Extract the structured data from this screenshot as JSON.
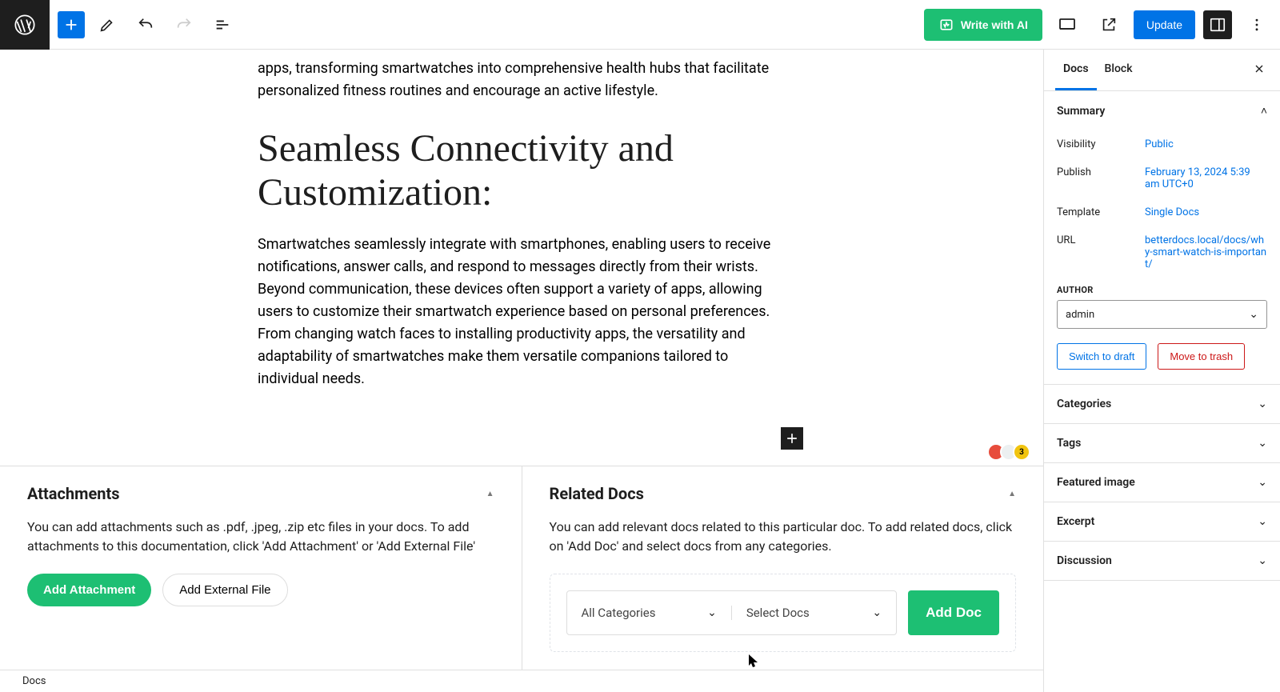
{
  "toolbar": {
    "write_ai": "Write with AI",
    "update": "Update"
  },
  "content": {
    "partial_paragraph": "apps, transforming smartwatches into comprehensive health hubs that facilitate personalized fitness routines and encourage an active lifestyle.",
    "heading": "Seamless Connectivity and Customization:",
    "paragraph2": "Smartwatches seamlessly integrate with smartphones, enabling users to receive notifications, answer calls, and respond to messages directly from their wrists. Beyond communication, these devices often support a variety of apps, allowing users to customize their smartwatch experience based on personal preferences. From changing watch faces to installing productivity apps, the versatility and adaptability of smartwatches make them versatile companions tailored to individual needs."
  },
  "attachments": {
    "title": "Attachments",
    "desc": "You can add attachments such as .pdf, .jpeg, .zip etc files in your docs. To add attachments to this documentation, click 'Add Attachment' or 'Add External File'",
    "add_btn": "Add Attachment",
    "ext_btn": "Add External File"
  },
  "related": {
    "title": "Related Docs",
    "desc": "You can add relevant docs related to this particular doc. To add related docs, click on 'Add Doc' and select docs from any categories.",
    "cat_placeholder": "All Categories",
    "doc_placeholder": "Select Docs",
    "add_btn": "Add Doc"
  },
  "sidebar": {
    "tabs": {
      "docs": "Docs",
      "block": "Block"
    },
    "summary": {
      "title": "Summary",
      "visibility_lbl": "Visibility",
      "visibility_val": "Public",
      "publish_lbl": "Publish",
      "publish_val": "February 13, 2024 5:39 am UTC+0",
      "template_lbl": "Template",
      "template_val": "Single Docs",
      "url_lbl": "URL",
      "url_val": "betterdocs.local/docs/why-smart-watch-is-important/",
      "author_lbl": "AUTHOR",
      "author_val": "admin",
      "draft_btn": "Switch to draft",
      "trash_btn": "Move to trash"
    },
    "panels": {
      "categories": "Categories",
      "tags": "Tags",
      "featured": "Featured image",
      "excerpt": "Excerpt",
      "discussion": "Discussion"
    }
  },
  "footer": {
    "breadcrumb": "Docs"
  },
  "badge_count": "3"
}
